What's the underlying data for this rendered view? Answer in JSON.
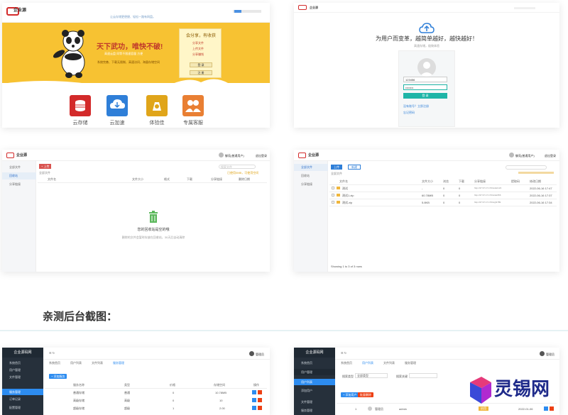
{
  "landing": {
    "topbar_text": "让云存储更便捷、轻松一路有网盘。",
    "slogan": "天下武功，唯快不破!",
    "subline": "高速云盘  同等不限速容量  方便",
    "features_line": "系统完善、下载无限制、高速访问、海量存储空间",
    "share_title": "会分享，有收获",
    "share_items": [
      "分享文件",
      "上传文件",
      "分享赚钱"
    ],
    "share_btn1": "登 录",
    "share_btn2": "注 册",
    "features": [
      "云存储",
      "云加速",
      "体验佳",
      "专属客服"
    ],
    "colors": {
      "banner": "#f7c232",
      "red": "#d32a2a",
      "blue": "#2f7fd8",
      "gold": "#e0a51a",
      "orange": "#e97f33"
    }
  },
  "login": {
    "headline": "为用户而变革，越简单越好，越快越好！",
    "subline": "高速存储，极致体验",
    "username": "123456",
    "password": "••••••••",
    "login_btn": "登 录",
    "link1": "没有账号？立即注册",
    "link2": "忘记密码"
  },
  "files_empty": {
    "user": "御苑(普通用户)",
    "logout": "退出登录",
    "sidebar": [
      "全部文件",
      "回收站",
      "分享链接"
    ],
    "upload_btn": "+ 上传",
    "path_note": "全部文件",
    "search_placeholder": "搜索文件",
    "space_note": "已使用0MB，可使用空间",
    "columns": [
      "文件名",
      "文件大小",
      "格式",
      "下载",
      "分享链接",
      "删除日期"
    ],
    "empty_title": "您的回收站是空的哦",
    "empty_sub": "删除的文件会暂时存放在回收站，30天后自动清除"
  },
  "files_list": {
    "user": "御苑(普通用户)",
    "logout": "退出登录",
    "sidebar": [
      "全部文件",
      "回收站",
      "分享链接"
    ],
    "upload_btn": "上传",
    "new_btn": "新建",
    "path_note": "全部文件",
    "columns": [
      "文件名",
      "文件大小",
      "浏览",
      "下载",
      "分享链接",
      "提取码",
      "修改日期"
    ],
    "rows": [
      {
        "name": "测试",
        "size": "-",
        "views": "0",
        "downloads": "0",
        "link": "http://47.97.17.170/s/abc123",
        "code": "",
        "date": "2022-06-16 17:47"
      },
      {
        "name": "测试1.zip",
        "size": "60.78MB",
        "views": "0",
        "downloads": "0",
        "link": "http://47.97.17.170/s/def456",
        "code": "",
        "date": "2022-06-16 17:37"
      },
      {
        "name": "测试.zip",
        "size": "5.8KB",
        "views": "0",
        "downloads": "0",
        "link": "http://47.97.17.170/s/ghi789",
        "code": "",
        "date": "2022-06-16 17:34"
      }
    ],
    "pager": "Showing 1 to 3 of 3 rows"
  },
  "heading": "亲测后台截图：",
  "admin1": {
    "brand": "企业源码网",
    "menu": [
      "系统首页",
      "用户管理",
      "文件管理",
      "服务管理",
      "订单记录",
      "配置管理"
    ],
    "active_index": 3,
    "tabs": [
      "系统首页",
      "用户列表",
      "文件列表",
      "服务管理"
    ],
    "admin_name": "管理员",
    "add_btn": "+ 添加服务",
    "columns": [
      "服务名称",
      "类型",
      "价格",
      "存储空间",
      "操作"
    ],
    "rows": [
      [
        "普通存储",
        "普通",
        "0",
        "10.78MB"
      ],
      [
        "高级存储",
        "高级",
        "0",
        "10"
      ],
      [
        "超级存储",
        "超级",
        "1",
        "2.00"
      ]
    ]
  },
  "admin2": {
    "brand": "企业源码网",
    "menu": [
      "系统首页",
      "用户管理",
      "用户列表",
      "添加用户",
      "文件管理",
      "服务管理"
    ],
    "active_index": 2,
    "tabs": [
      "系统首页",
      "用户列表",
      "文件列表",
      "服务管理"
    ],
    "admin_name": "管理员",
    "filter_label": "搜索类型",
    "filter_value": "全部类型",
    "search_label": "搜索关键",
    "add_btn": "+ 添加用户",
    "del_btn": "批量删除",
    "row": [
      "1",
      "管理员",
      "admin",
      "启用",
      "2022-01-06"
    ]
  },
  "watermark": {
    "text": "灵锡网"
  }
}
